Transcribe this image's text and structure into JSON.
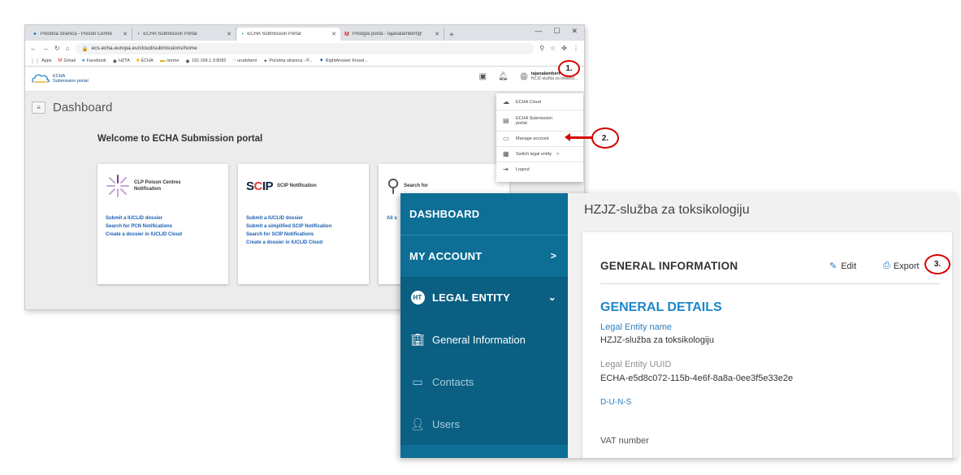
{
  "browser": {
    "tabs": [
      {
        "title": "Početna stranica - Poison Centre",
        "icon": "pcn-favicon"
      },
      {
        "title": "ECHA Submission Portal",
        "icon": "echa-favicon"
      },
      {
        "title": "ECHA Submission Portal",
        "icon": "echa-favicon",
        "active": true
      },
      {
        "title": "Pristigla pošta - tajanalambert@",
        "icon": "gmail-favicon"
      }
    ],
    "new_tab": "+",
    "url": "ecs.echa.europa.eu/cloud/submissions/home",
    "bookmarks": [
      "Apps",
      "Gmail",
      "Facebook",
      "HZTA",
      "ECHA",
      "norme",
      "192.168.1.3:8082",
      "urudzbeni",
      "Početna stranica - P...",
      "RightAnswer Knowl..."
    ]
  },
  "portal": {
    "logo_line1": "ECHA",
    "logo_line2": "Submission portal",
    "user_name": "tajanalambert",
    "user_entity": "HZJZ-služba za toksikol...",
    "dashboard_title": "Dashboard",
    "welcome": "Welcome to ECHA Submission portal",
    "cards": [
      {
        "title_line1": "CLP Poison Centres",
        "title_line2": "Notification",
        "links": [
          "Submit a IUCLID dossier",
          "Search for PCN Notifications",
          "Create a dossier in IUCLID Cloud"
        ]
      },
      {
        "logo_prefix": "S",
        "logo_mid": "C",
        "logo_suffix": "IP",
        "title_line1": "SCIP Notification",
        "links": [
          "Submit a IUCLID dossier",
          "Submit a simplified SCIP Notification",
          "Search for SCIP Notifications",
          "Create a dossier in IUCLID Cloud"
        ]
      },
      {
        "title_line1": "Search for",
        "links": [
          "All s"
        ]
      }
    ],
    "menu": [
      {
        "label": "ECHA Cloud",
        "icon": "cloud-icon"
      },
      {
        "label_line1": "ECHA Submission",
        "label_line2": "portal",
        "icon": "portal-icon"
      },
      {
        "label": "Manage account",
        "icon": "account-card-icon"
      },
      {
        "label": "Switch legal entity",
        "icon": "building-icon",
        "suffix": ">"
      },
      {
        "label": "Logout",
        "icon": "logout-icon"
      }
    ]
  },
  "callouts": {
    "step1": "1.",
    "step2": "2.",
    "step3": "3."
  },
  "legal": {
    "nav": {
      "dashboard": "DASHBOARD",
      "my_account": "MY ACCOUNT",
      "my_account_chev": ">",
      "legal_entity": "LEGAL ENTITY",
      "legal_badge": "HT",
      "legal_chev": "v",
      "general_information": "General Information",
      "contacts": "Contacts",
      "users": "Users"
    },
    "entity_title": "HZJZ-služba za toksikologiju",
    "panel_title": "GENERAL INFORMATION",
    "edit": "Edit",
    "export": "Export",
    "section_title": "GENERAL DETAILS",
    "fields": {
      "name_label": "Legal Entity name",
      "name_value": "HZJZ-služba za toksikologiju",
      "uuid_label": "Legal Entity UUID",
      "uuid_value": "ECHA-e5d8c072-115b-4e6f-8a8a-0ee3f5e33e2e",
      "duns_label": "D-U-N-S",
      "vat_label": "VAT number"
    }
  },
  "colors": {
    "sidebar": "#0d6e96",
    "accent_blue": "#1d86c9",
    "callout_red": "#d60000"
  }
}
